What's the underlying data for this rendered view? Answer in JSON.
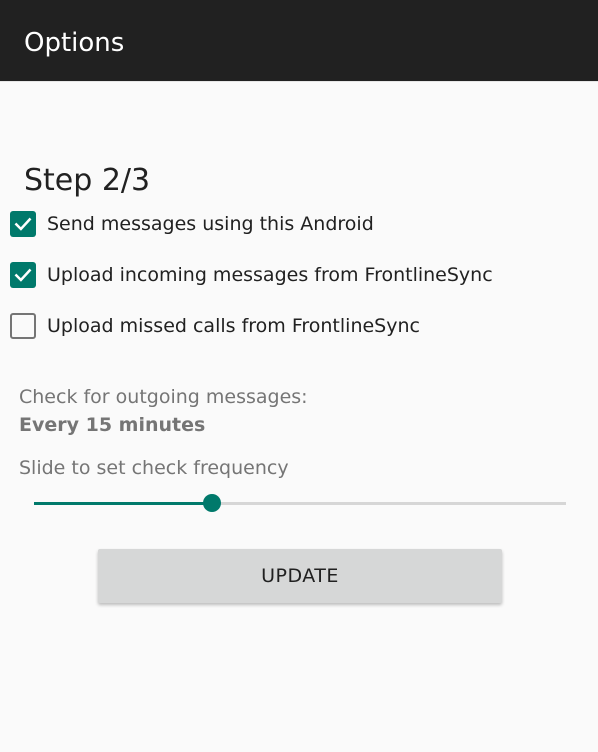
{
  "appbar": {
    "title": "Options",
    "background_color": "#212121"
  },
  "step": {
    "title": "Step 2/3"
  },
  "options": [
    {
      "label": "Send messages using this Android",
      "checked": true
    },
    {
      "label": "Upload incoming messages from FrontlineSync",
      "checked": true
    },
    {
      "label": "Upload missed calls from FrontlineSync",
      "checked": false
    }
  ],
  "frequency": {
    "heading": "Check for outgoing messages:",
    "value": "Every 15 minutes",
    "slider_hint": "Slide to set check frequency",
    "slider_level": 0.335
  },
  "actions": {
    "update_label": "UPDATE"
  },
  "colors": {
    "accent": "#00796b",
    "checkbox_unchecked": "#757575",
    "button_bg": "#d6d7d7"
  },
  "icons": {
    "checkmark": "check-icon"
  }
}
